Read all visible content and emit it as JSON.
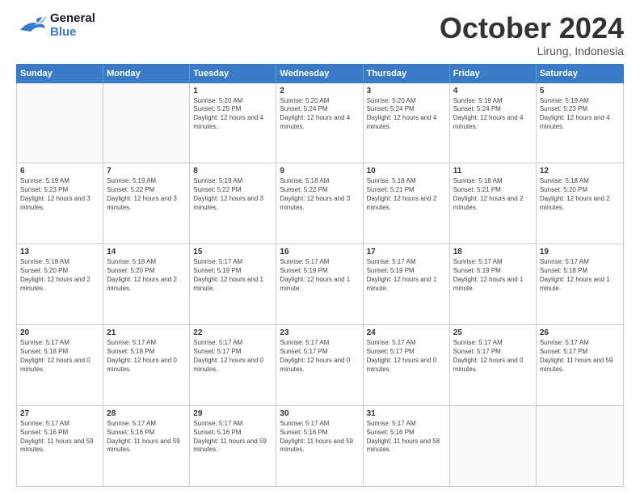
{
  "header": {
    "logo": {
      "general": "General",
      "blue": "Blue"
    },
    "month": "October 2024",
    "location": "Lirung, Indonesia"
  },
  "weekdays": [
    "Sunday",
    "Monday",
    "Tuesday",
    "Wednesday",
    "Thursday",
    "Friday",
    "Saturday"
  ],
  "weeks": [
    [
      {
        "day": "",
        "info": "",
        "empty": true
      },
      {
        "day": "",
        "info": "",
        "empty": true
      },
      {
        "day": "1",
        "info": "Sunrise: 5:20 AM\nSunset: 5:25 PM\nDaylight: 12 hours and 4 minutes."
      },
      {
        "day": "2",
        "info": "Sunrise: 5:20 AM\nSunset: 5:24 PM\nDaylight: 12 hours and 4 minutes."
      },
      {
        "day": "3",
        "info": "Sunrise: 5:20 AM\nSunset: 5:24 PM\nDaylight: 12 hours and 4 minutes."
      },
      {
        "day": "4",
        "info": "Sunrise: 5:19 AM\nSunset: 5:24 PM\nDaylight: 12 hours and 4 minutes."
      },
      {
        "day": "5",
        "info": "Sunrise: 5:19 AM\nSunset: 5:23 PM\nDaylight: 12 hours and 4 minutes."
      }
    ],
    [
      {
        "day": "6",
        "info": "Sunrise: 5:19 AM\nSunset: 5:23 PM\nDaylight: 12 hours and 3 minutes."
      },
      {
        "day": "7",
        "info": "Sunrise: 5:19 AM\nSunset: 5:22 PM\nDaylight: 12 hours and 3 minutes."
      },
      {
        "day": "8",
        "info": "Sunrise: 5:19 AM\nSunset: 5:22 PM\nDaylight: 12 hours and 3 minutes."
      },
      {
        "day": "9",
        "info": "Sunrise: 5:18 AM\nSunset: 5:22 PM\nDaylight: 12 hours and 3 minutes."
      },
      {
        "day": "10",
        "info": "Sunrise: 5:18 AM\nSunset: 5:21 PM\nDaylight: 12 hours and 2 minutes."
      },
      {
        "day": "11",
        "info": "Sunrise: 5:18 AM\nSunset: 5:21 PM\nDaylight: 12 hours and 2 minutes."
      },
      {
        "day": "12",
        "info": "Sunrise: 5:18 AM\nSunset: 5:20 PM\nDaylight: 12 hours and 2 minutes."
      }
    ],
    [
      {
        "day": "13",
        "info": "Sunrise: 5:18 AM\nSunset: 5:20 PM\nDaylight: 12 hours and 2 minutes."
      },
      {
        "day": "14",
        "info": "Sunrise: 5:18 AM\nSunset: 5:20 PM\nDaylight: 12 hours and 2 minutes."
      },
      {
        "day": "15",
        "info": "Sunrise: 5:17 AM\nSunset: 5:19 PM\nDaylight: 12 hours and 1 minute."
      },
      {
        "day": "16",
        "info": "Sunrise: 5:17 AM\nSunset: 5:19 PM\nDaylight: 12 hours and 1 minute."
      },
      {
        "day": "17",
        "info": "Sunrise: 5:17 AM\nSunset: 5:19 PM\nDaylight: 12 hours and 1 minute."
      },
      {
        "day": "18",
        "info": "Sunrise: 5:17 AM\nSunset: 5:19 PM\nDaylight: 12 hours and 1 minute."
      },
      {
        "day": "19",
        "info": "Sunrise: 5:17 AM\nSunset: 5:18 PM\nDaylight: 12 hours and 1 minute."
      }
    ],
    [
      {
        "day": "20",
        "info": "Sunrise: 5:17 AM\nSunset: 5:18 PM\nDaylight: 12 hours and 0 minutes."
      },
      {
        "day": "21",
        "info": "Sunrise: 5:17 AM\nSunset: 5:18 PM\nDaylight: 12 hours and 0 minutes."
      },
      {
        "day": "22",
        "info": "Sunrise: 5:17 AM\nSunset: 5:17 PM\nDaylight: 12 hours and 0 minutes."
      },
      {
        "day": "23",
        "info": "Sunrise: 5:17 AM\nSunset: 5:17 PM\nDaylight: 12 hours and 0 minutes."
      },
      {
        "day": "24",
        "info": "Sunrise: 5:17 AM\nSunset: 5:17 PM\nDaylight: 12 hours and 0 minutes."
      },
      {
        "day": "25",
        "info": "Sunrise: 5:17 AM\nSunset: 5:17 PM\nDaylight: 12 hours and 0 minutes."
      },
      {
        "day": "26",
        "info": "Sunrise: 5:17 AM\nSunset: 5:17 PM\nDaylight: 11 hours and 59 minutes."
      }
    ],
    [
      {
        "day": "27",
        "info": "Sunrise: 5:17 AM\nSunset: 5:16 PM\nDaylight: 11 hours and 59 minutes."
      },
      {
        "day": "28",
        "info": "Sunrise: 5:17 AM\nSunset: 5:16 PM\nDaylight: 11 hours and 59 minutes."
      },
      {
        "day": "29",
        "info": "Sunrise: 5:17 AM\nSunset: 5:16 PM\nDaylight: 11 hours and 59 minutes."
      },
      {
        "day": "30",
        "info": "Sunrise: 5:17 AM\nSunset: 5:16 PM\nDaylight: 11 hours and 59 minutes."
      },
      {
        "day": "31",
        "info": "Sunrise: 5:17 AM\nSunset: 5:16 PM\nDaylight: 11 hours and 58 minutes."
      },
      {
        "day": "",
        "info": "",
        "empty": true
      },
      {
        "day": "",
        "info": "",
        "empty": true
      }
    ]
  ]
}
